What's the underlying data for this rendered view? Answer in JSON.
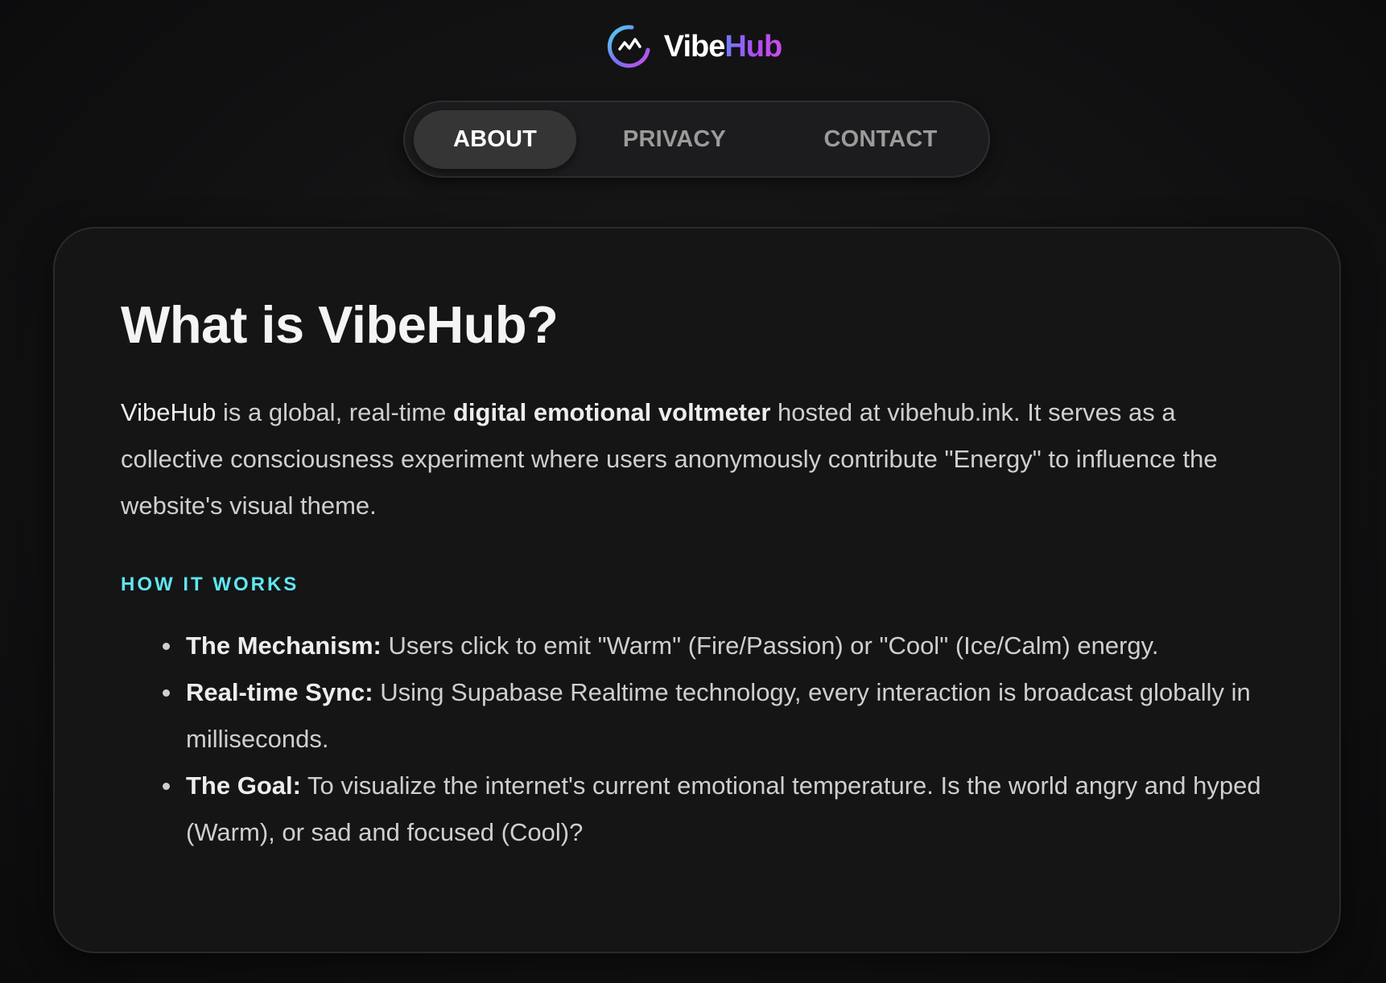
{
  "brand": {
    "name_part1": "Vibe",
    "name_part2": "Hub",
    "icon": "pulse-ring-logo-icon",
    "colors": {
      "gradient_start": "#4fd8f0",
      "gradient_mid": "#7d6cf6",
      "gradient_end": "#c84ee8"
    }
  },
  "nav": {
    "tabs": [
      {
        "label": "ABOUT",
        "active": true
      },
      {
        "label": "PRIVACY",
        "active": false
      },
      {
        "label": "CONTACT",
        "active": false
      }
    ]
  },
  "main": {
    "title": "What is VibeHub?",
    "intro": {
      "brand": "VibeHub",
      "text1": " is a global, real-time ",
      "emphasis": "digital emotional voltmeter",
      "text2": " hosted at vibehub.ink. It serves as a collective consciousness experiment where users anonymously contribute \"Energy\" to influence the website's visual theme."
    },
    "section_heading": "HOW IT WORKS",
    "items": [
      {
        "label": "The Mechanism:",
        "text": " Users click to emit \"Warm\" (Fire/Passion) or \"Cool\" (Ice/Calm) energy."
      },
      {
        "label": "Real-time Sync:",
        "text": " Using Supabase Realtime technology, every interaction is broadcast globally in milliseconds."
      },
      {
        "label": "The Goal:",
        "text": " To visualize the internet's current emotional temperature. Is the world angry and hyped (Warm), or sad and focused (Cool)?"
      }
    ]
  },
  "colors": {
    "background": "#121213",
    "card": "#151516",
    "accent_heading": "#5fe6f2",
    "active_tab": "#353536"
  }
}
